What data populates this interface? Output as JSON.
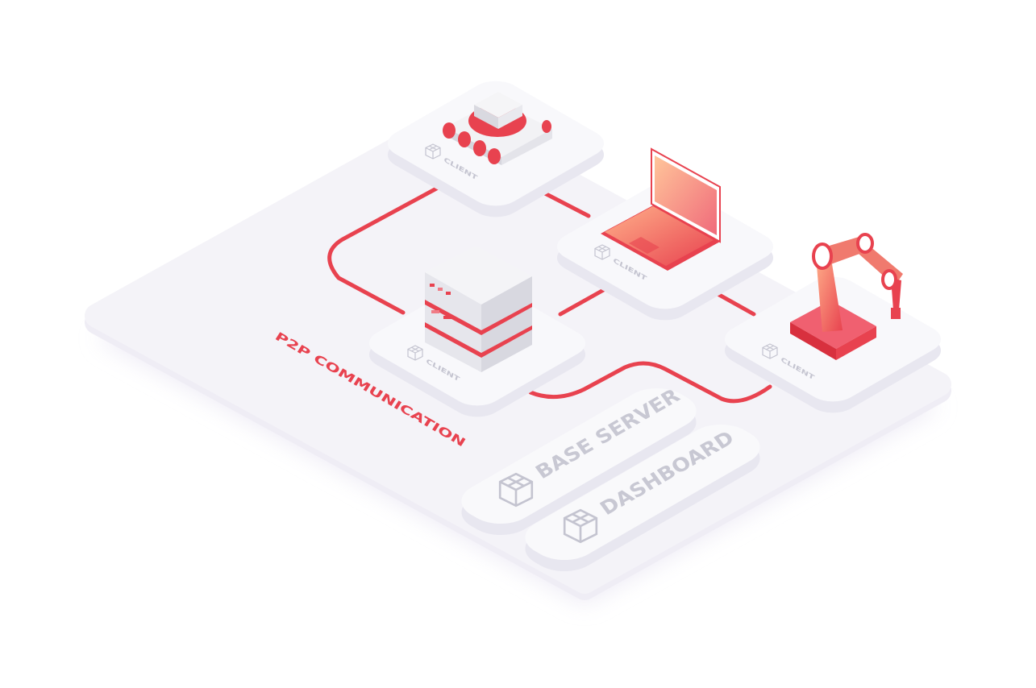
{
  "diagram": {
    "title": "P2P COMMUNICATION",
    "nodes": [
      {
        "id": "rover",
        "label": "CLIENT",
        "icon": "rover-robot-icon"
      },
      {
        "id": "laptop",
        "label": "CLIENT",
        "icon": "laptop-icon"
      },
      {
        "id": "server",
        "label": "CLIENT",
        "icon": "server-rack-icon"
      },
      {
        "id": "robot-arm",
        "label": "CLIENT",
        "icon": "robot-arm-icon"
      }
    ],
    "panels": [
      {
        "label": "BASE SERVER",
        "icon": "cube-icon"
      },
      {
        "label": "DASHBOARD",
        "icon": "cube-icon"
      }
    ]
  },
  "colors": {
    "accent": "#e8424f",
    "accent_light": "#ff8a80",
    "tile": "#f7f7fa",
    "platform": "#f3f2f7",
    "label_gray": "#c4c4d0"
  }
}
